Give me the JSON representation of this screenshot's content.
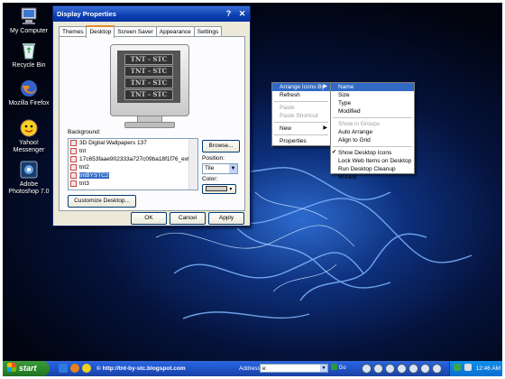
{
  "desktop": {
    "icons": [
      {
        "label": "My Computer"
      },
      {
        "label": "Recycle Bin"
      },
      {
        "label": "Mozilla Firefox"
      },
      {
        "label": "Yahoo! Messenger"
      },
      {
        "label": "Adobe Photoshop 7.0"
      }
    ]
  },
  "dialog": {
    "title": "Display Properties",
    "help_glyph": "?",
    "close_glyph": "✕",
    "tabs": [
      "Themes",
      "Desktop",
      "Screen Saver",
      "Appearance",
      "Settings"
    ],
    "active_tab": "Desktop",
    "preview_text": "TNT - STC",
    "background_label": "Background:",
    "backgrounds": [
      "3D Digital Wallpapers 137",
      "tnt",
      "17c653faae902333a727c09ba18f1f76_extra_ar",
      "tnt2",
      "tntBYSTC2",
      "tnt3"
    ],
    "selected_background": "tntBYSTC2",
    "browse_label": "Browse...",
    "position_label": "Position:",
    "position_value": "Tile",
    "color_label": "Color:",
    "customize_label": "Customize Desktop...",
    "ok_label": "OK",
    "cancel_label": "Cancel",
    "apply_label": "Apply"
  },
  "context_menu": {
    "items": [
      {
        "label": "Arrange Icons By",
        "submenu": true,
        "highlighted": true
      },
      {
        "label": "Refresh"
      },
      {
        "separator": true
      },
      {
        "label": "Paste",
        "disabled": true
      },
      {
        "label": "Paste Shortcut",
        "disabled": true
      },
      {
        "separator": true
      },
      {
        "label": "New",
        "submenu": true
      },
      {
        "separator": true
      },
      {
        "label": "Properties"
      }
    ],
    "submenu_arrow": "▶"
  },
  "arrange_submenu": {
    "items": [
      {
        "label": "Name",
        "highlighted": true
      },
      {
        "label": "Size"
      },
      {
        "label": "Type"
      },
      {
        "label": "Modified"
      },
      {
        "separator": true
      },
      {
        "label": "Show in Groups",
        "disabled": true
      },
      {
        "label": "Auto Arrange"
      },
      {
        "label": "Align to Grid"
      },
      {
        "separator": true
      },
      {
        "label": "Show Desktop Icons",
        "checked": true
      },
      {
        "label": "Lock Web Items on Desktop"
      },
      {
        "label": "Run Desktop Cleanup Wizard"
      }
    ],
    "check_glyph": "✔"
  },
  "taskbar": {
    "start_label": "start",
    "copyright_text": "© http://tnt-by-stc.blogspot.com",
    "address_label": "Address",
    "address_value": "e:",
    "go_label": "Go",
    "clock": "12:46 AM"
  },
  "colors": {
    "title_bar": "#0a3fb0",
    "selection": "#316ac5",
    "start_green": "#2d8a2d",
    "taskbar_blue": "#245edb"
  }
}
